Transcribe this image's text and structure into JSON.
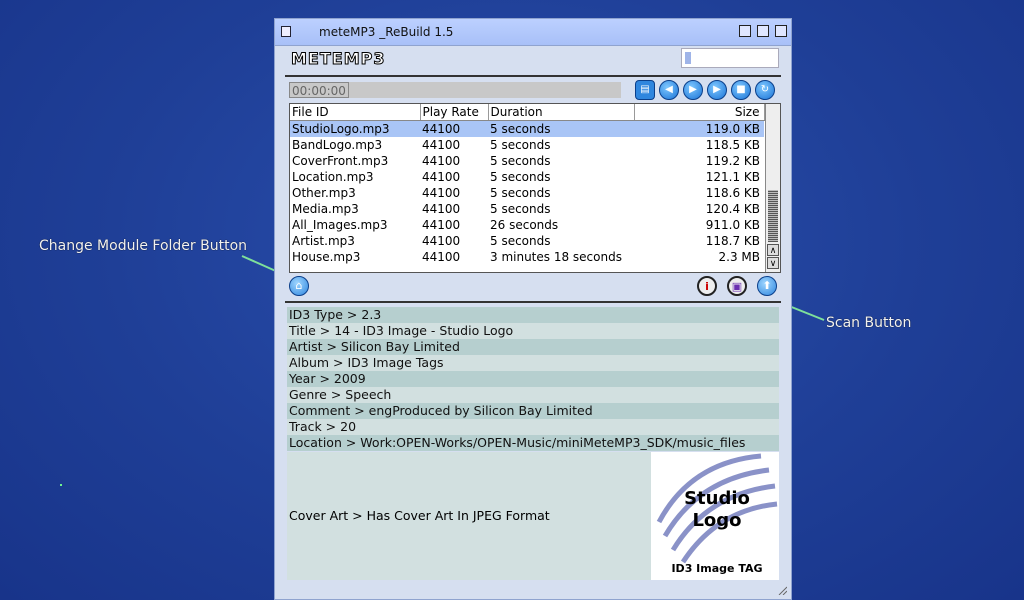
{
  "window": {
    "title": "meteMP3 _ReBuild 1.5",
    "logo": "METEMP3"
  },
  "player": {
    "time": "00:00:00"
  },
  "file_list": {
    "columns": [
      "File ID",
      "Play Rate",
      "Duration",
      "Size"
    ],
    "rows": [
      {
        "id": "StudioLogo.mp3",
        "rate": "44100",
        "duration": "5 seconds",
        "size": "119.0 KB"
      },
      {
        "id": "BandLogo.mp3",
        "rate": "44100",
        "duration": "5 seconds",
        "size": "118.5 KB"
      },
      {
        "id": "CoverFront.mp3",
        "rate": "44100",
        "duration": "5 seconds",
        "size": "119.2 KB"
      },
      {
        "id": "Location.mp3",
        "rate": "44100",
        "duration": "5 seconds",
        "size": "121.1 KB"
      },
      {
        "id": "Other.mp3",
        "rate": "44100",
        "duration": "5 seconds",
        "size": "118.6 KB"
      },
      {
        "id": "Media.mp3",
        "rate": "44100",
        "duration": "5 seconds",
        "size": "120.4 KB"
      },
      {
        "id": "All_Images.mp3",
        "rate": "44100",
        "duration": "26 seconds",
        "size": "911.0 KB"
      },
      {
        "id": "Artist.mp3",
        "rate": "44100",
        "duration": "5 seconds",
        "size": "118.7 KB"
      },
      {
        "id": "House.mp3",
        "rate": "44100",
        "duration": "3 minutes 18 seconds",
        "size": "2.3 MB"
      }
    ],
    "selected_index": 0
  },
  "tags": [
    {
      "label": "ID3 Type > 2.3"
    },
    {
      "label": "Title > 14 - ID3 Image - Studio Logo"
    },
    {
      "label": "Artist > Silicon Bay Limited"
    },
    {
      "label": "Album > ID3 Image Tags"
    },
    {
      "label": "Year > 2009"
    },
    {
      "label": "Genre > Speech"
    },
    {
      "label": "Comment > engProduced by Silicon Bay Limited"
    },
    {
      "label": "Track > 20"
    },
    {
      "label": "Location > Work:OPEN-Works/OPEN-Music/miniMeteMP3_SDK/music_files"
    }
  ],
  "cover": {
    "label": "Cover Art > Has Cover Art In JPEG Format",
    "art_line1": "Studio",
    "art_line2": "Logo",
    "art_caption": "ID3 Image TAG"
  },
  "callouts": {
    "left": "Change Module Folder Button",
    "right": "Scan Button",
    "color": "#7ee09a"
  }
}
